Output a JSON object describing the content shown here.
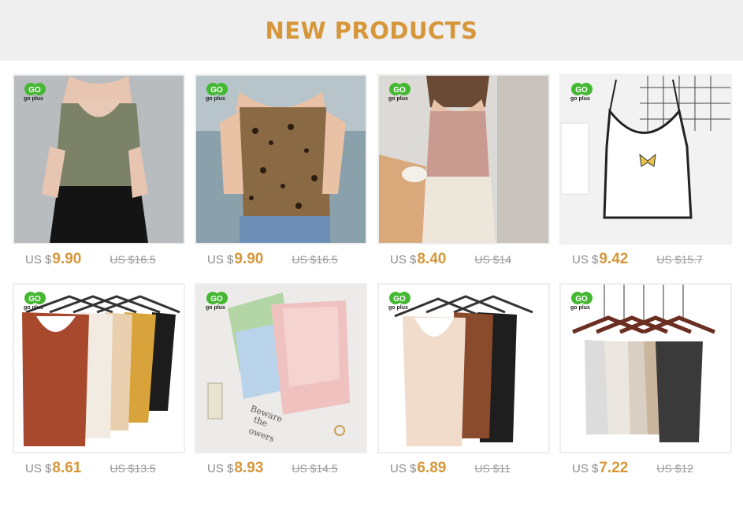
{
  "header": {
    "title": "NEW PRODUCTS"
  },
  "colors": {
    "accent": "#d6973a",
    "header_bg": "#efefef",
    "logo_green": "#44b832"
  },
  "brand": {
    "logo_text": "GO",
    "logo_subtext": "go plus"
  },
  "products": [
    {
      "currency": "US $",
      "price": "9.90",
      "original": "US $16.5",
      "image": "olive-green-v-neck-cami"
    },
    {
      "currency": "US $",
      "price": "9.90",
      "original": "US $16.5",
      "image": "leopard-print-crop-cami"
    },
    {
      "currency": "US $",
      "price": "8.40",
      "original": "US $14",
      "image": "pink-square-neck-cami"
    },
    {
      "currency": "US $",
      "price": "9.42",
      "original": "US $15.7",
      "image": "white-butterfly-crop-cami"
    },
    {
      "currency": "US $",
      "price": "8.61",
      "original": "US $13.5",
      "image": "knit-tanks-on-hangers"
    },
    {
      "currency": "US $",
      "price": "8.93",
      "original": "US $14.5",
      "image": "silk-camis-flatlay"
    },
    {
      "currency": "US $",
      "price": "6.89",
      "original": "US $11",
      "image": "ribbed-tanks-on-hangers"
    },
    {
      "currency": "US $",
      "price": "7.22",
      "original": "US $12",
      "image": "glitter-camis-on-hangers"
    }
  ]
}
